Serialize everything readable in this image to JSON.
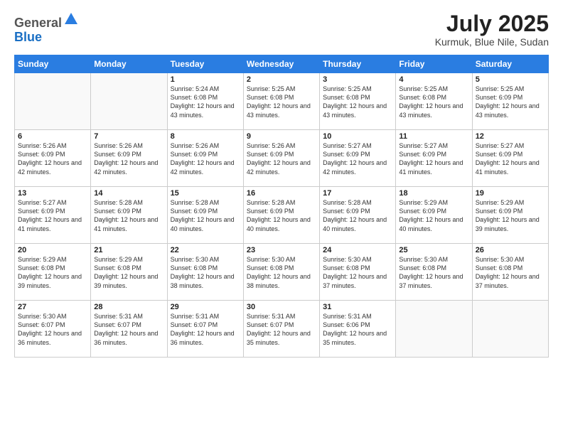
{
  "header": {
    "logo_line1": "General",
    "logo_line2": "Blue",
    "month_year": "July 2025",
    "location": "Kurmuk, Blue Nile, Sudan"
  },
  "days_of_week": [
    "Sunday",
    "Monday",
    "Tuesday",
    "Wednesday",
    "Thursday",
    "Friday",
    "Saturday"
  ],
  "weeks": [
    [
      {
        "day": "",
        "sunrise": "",
        "sunset": "",
        "daylight": ""
      },
      {
        "day": "",
        "sunrise": "",
        "sunset": "",
        "daylight": ""
      },
      {
        "day": "1",
        "sunrise": "Sunrise: 5:24 AM",
        "sunset": "Sunset: 6:08 PM",
        "daylight": "Daylight: 12 hours and 43 minutes."
      },
      {
        "day": "2",
        "sunrise": "Sunrise: 5:25 AM",
        "sunset": "Sunset: 6:08 PM",
        "daylight": "Daylight: 12 hours and 43 minutes."
      },
      {
        "day": "3",
        "sunrise": "Sunrise: 5:25 AM",
        "sunset": "Sunset: 6:08 PM",
        "daylight": "Daylight: 12 hours and 43 minutes."
      },
      {
        "day": "4",
        "sunrise": "Sunrise: 5:25 AM",
        "sunset": "Sunset: 6:08 PM",
        "daylight": "Daylight: 12 hours and 43 minutes."
      },
      {
        "day": "5",
        "sunrise": "Sunrise: 5:25 AM",
        "sunset": "Sunset: 6:09 PM",
        "daylight": "Daylight: 12 hours and 43 minutes."
      }
    ],
    [
      {
        "day": "6",
        "sunrise": "Sunrise: 5:26 AM",
        "sunset": "Sunset: 6:09 PM",
        "daylight": "Daylight: 12 hours and 42 minutes."
      },
      {
        "day": "7",
        "sunrise": "Sunrise: 5:26 AM",
        "sunset": "Sunset: 6:09 PM",
        "daylight": "Daylight: 12 hours and 42 minutes."
      },
      {
        "day": "8",
        "sunrise": "Sunrise: 5:26 AM",
        "sunset": "Sunset: 6:09 PM",
        "daylight": "Daylight: 12 hours and 42 minutes."
      },
      {
        "day": "9",
        "sunrise": "Sunrise: 5:26 AM",
        "sunset": "Sunset: 6:09 PM",
        "daylight": "Daylight: 12 hours and 42 minutes."
      },
      {
        "day": "10",
        "sunrise": "Sunrise: 5:27 AM",
        "sunset": "Sunset: 6:09 PM",
        "daylight": "Daylight: 12 hours and 42 minutes."
      },
      {
        "day": "11",
        "sunrise": "Sunrise: 5:27 AM",
        "sunset": "Sunset: 6:09 PM",
        "daylight": "Daylight: 12 hours and 41 minutes."
      },
      {
        "day": "12",
        "sunrise": "Sunrise: 5:27 AM",
        "sunset": "Sunset: 6:09 PM",
        "daylight": "Daylight: 12 hours and 41 minutes."
      }
    ],
    [
      {
        "day": "13",
        "sunrise": "Sunrise: 5:27 AM",
        "sunset": "Sunset: 6:09 PM",
        "daylight": "Daylight: 12 hours and 41 minutes."
      },
      {
        "day": "14",
        "sunrise": "Sunrise: 5:28 AM",
        "sunset": "Sunset: 6:09 PM",
        "daylight": "Daylight: 12 hours and 41 minutes."
      },
      {
        "day": "15",
        "sunrise": "Sunrise: 5:28 AM",
        "sunset": "Sunset: 6:09 PM",
        "daylight": "Daylight: 12 hours and 40 minutes."
      },
      {
        "day": "16",
        "sunrise": "Sunrise: 5:28 AM",
        "sunset": "Sunset: 6:09 PM",
        "daylight": "Daylight: 12 hours and 40 minutes."
      },
      {
        "day": "17",
        "sunrise": "Sunrise: 5:28 AM",
        "sunset": "Sunset: 6:09 PM",
        "daylight": "Daylight: 12 hours and 40 minutes."
      },
      {
        "day": "18",
        "sunrise": "Sunrise: 5:29 AM",
        "sunset": "Sunset: 6:09 PM",
        "daylight": "Daylight: 12 hours and 40 minutes."
      },
      {
        "day": "19",
        "sunrise": "Sunrise: 5:29 AM",
        "sunset": "Sunset: 6:09 PM",
        "daylight": "Daylight: 12 hours and 39 minutes."
      }
    ],
    [
      {
        "day": "20",
        "sunrise": "Sunrise: 5:29 AM",
        "sunset": "Sunset: 6:08 PM",
        "daylight": "Daylight: 12 hours and 39 minutes."
      },
      {
        "day": "21",
        "sunrise": "Sunrise: 5:29 AM",
        "sunset": "Sunset: 6:08 PM",
        "daylight": "Daylight: 12 hours and 39 minutes."
      },
      {
        "day": "22",
        "sunrise": "Sunrise: 5:30 AM",
        "sunset": "Sunset: 6:08 PM",
        "daylight": "Daylight: 12 hours and 38 minutes."
      },
      {
        "day": "23",
        "sunrise": "Sunrise: 5:30 AM",
        "sunset": "Sunset: 6:08 PM",
        "daylight": "Daylight: 12 hours and 38 minutes."
      },
      {
        "day": "24",
        "sunrise": "Sunrise: 5:30 AM",
        "sunset": "Sunset: 6:08 PM",
        "daylight": "Daylight: 12 hours and 37 minutes."
      },
      {
        "day": "25",
        "sunrise": "Sunrise: 5:30 AM",
        "sunset": "Sunset: 6:08 PM",
        "daylight": "Daylight: 12 hours and 37 minutes."
      },
      {
        "day": "26",
        "sunrise": "Sunrise: 5:30 AM",
        "sunset": "Sunset: 6:08 PM",
        "daylight": "Daylight: 12 hours and 37 minutes."
      }
    ],
    [
      {
        "day": "27",
        "sunrise": "Sunrise: 5:30 AM",
        "sunset": "Sunset: 6:07 PM",
        "daylight": "Daylight: 12 hours and 36 minutes."
      },
      {
        "day": "28",
        "sunrise": "Sunrise: 5:31 AM",
        "sunset": "Sunset: 6:07 PM",
        "daylight": "Daylight: 12 hours and 36 minutes."
      },
      {
        "day": "29",
        "sunrise": "Sunrise: 5:31 AM",
        "sunset": "Sunset: 6:07 PM",
        "daylight": "Daylight: 12 hours and 36 minutes."
      },
      {
        "day": "30",
        "sunrise": "Sunrise: 5:31 AM",
        "sunset": "Sunset: 6:07 PM",
        "daylight": "Daylight: 12 hours and 35 minutes."
      },
      {
        "day": "31",
        "sunrise": "Sunrise: 5:31 AM",
        "sunset": "Sunset: 6:06 PM",
        "daylight": "Daylight: 12 hours and 35 minutes."
      },
      {
        "day": "",
        "sunrise": "",
        "sunset": "",
        "daylight": ""
      },
      {
        "day": "",
        "sunrise": "",
        "sunset": "",
        "daylight": ""
      }
    ]
  ]
}
